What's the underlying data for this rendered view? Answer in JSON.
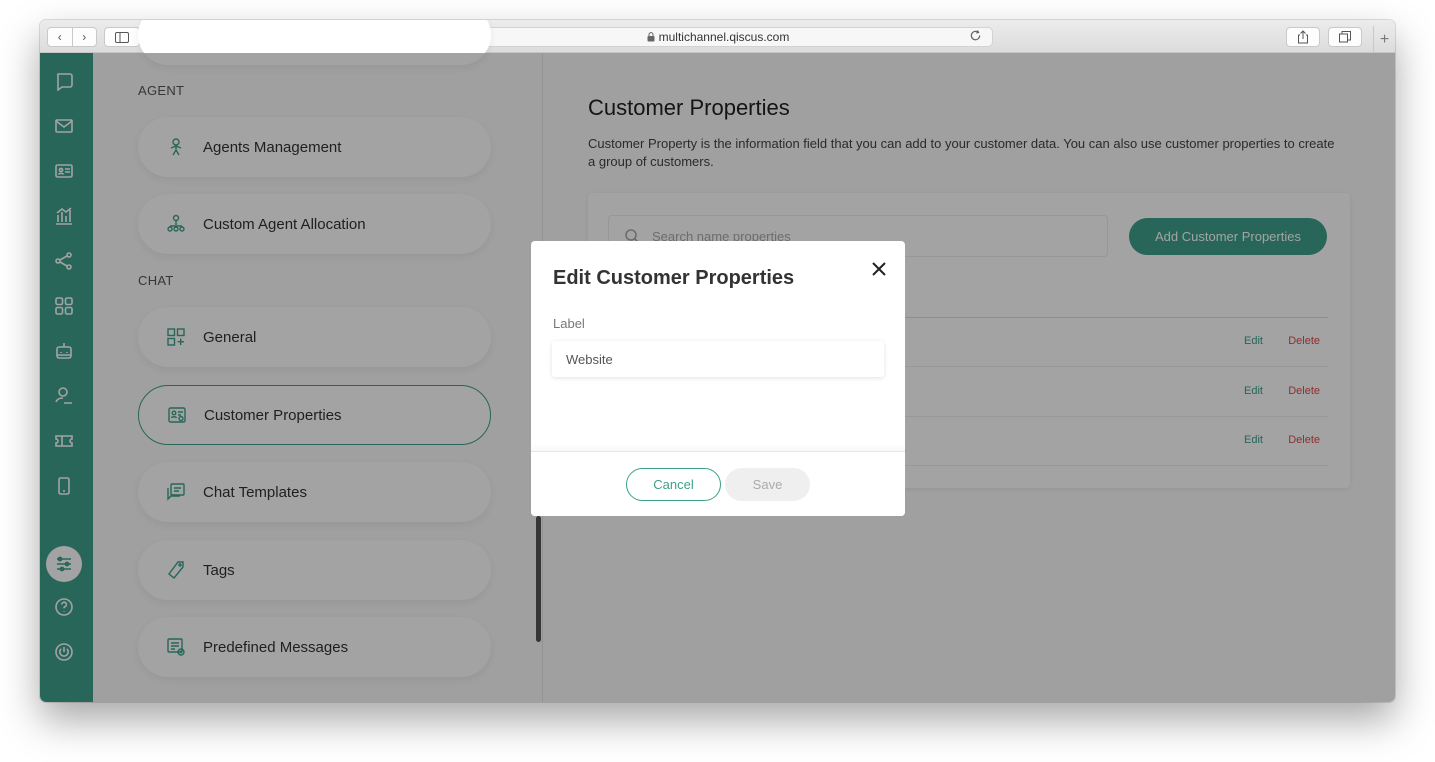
{
  "browser": {
    "address": "multichannel.qiscus.com",
    "back_glyph": "‹",
    "forward_glyph": "›",
    "new_tab_glyph": "+"
  },
  "rail": {
    "icons": [
      "chat-bubble-icon",
      "mail-icon",
      "contact-card-icon",
      "analytics-icon",
      "integration-icon",
      "apps-grid-icon",
      "bot-icon",
      "agent-icon",
      "ticket-icon",
      "mobile-icon",
      "settings-sliders-icon",
      "help-icon",
      "power-icon"
    ]
  },
  "settings_menu": {
    "section_agent": "AGENT",
    "agents_management": "Agents Management",
    "custom_agent_allocation": "Custom Agent Allocation",
    "section_chat": "CHAT",
    "general": "General",
    "customer_properties": "Customer Properties",
    "chat_templates": "Chat Templates",
    "tags": "Tags",
    "predefined_messages": "Predefined Messages"
  },
  "main": {
    "title": "Customer Properties",
    "description": "Customer Property is the information field that you can add to your customer data. You can also use customer properties to create a group of customers.",
    "search_placeholder": "Search name properties",
    "add_button": "Add Customer Properties",
    "rows": [
      {
        "edit": "Edit",
        "delete": "Delete"
      },
      {
        "edit": "Edit",
        "delete": "Delete"
      },
      {
        "edit": "Edit",
        "delete": "Delete"
      }
    ]
  },
  "modal": {
    "title": "Edit Customer Properties",
    "label": "Label",
    "label_value": "Website",
    "cancel": "Cancel",
    "save": "Save"
  },
  "colors": {
    "brand": "#3ea08a",
    "danger": "#e04a4a"
  }
}
